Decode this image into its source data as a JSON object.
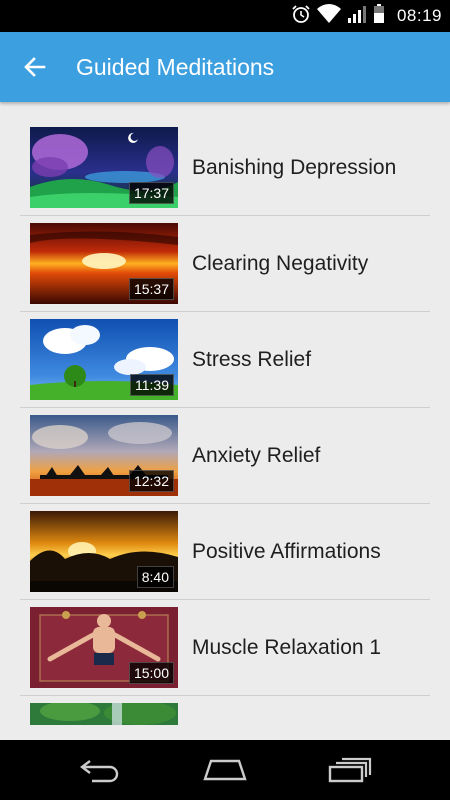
{
  "status_bar": {
    "time": "08:19",
    "icons": [
      "alarm-icon",
      "wifi-icon",
      "signal-icon",
      "battery-icon"
    ]
  },
  "app_bar": {
    "title": "Guided Meditations",
    "back_icon": "arrow-back-icon",
    "color": "#3b9fe0"
  },
  "meditations": [
    {
      "title": "Banishing Depression",
      "duration": "17:37"
    },
    {
      "title": "Clearing Negativity",
      "duration": "15:37"
    },
    {
      "title": "Stress Relief",
      "duration": "11:39"
    },
    {
      "title": "Anxiety Relief",
      "duration": "12:32"
    },
    {
      "title": "Positive Affirmations",
      "duration": "8:40"
    },
    {
      "title": "Muscle Relaxation 1",
      "duration": "15:00"
    }
  ],
  "nav_bar": {
    "icons": [
      "back-nav-icon",
      "home-nav-icon",
      "recents-nav-icon"
    ]
  }
}
